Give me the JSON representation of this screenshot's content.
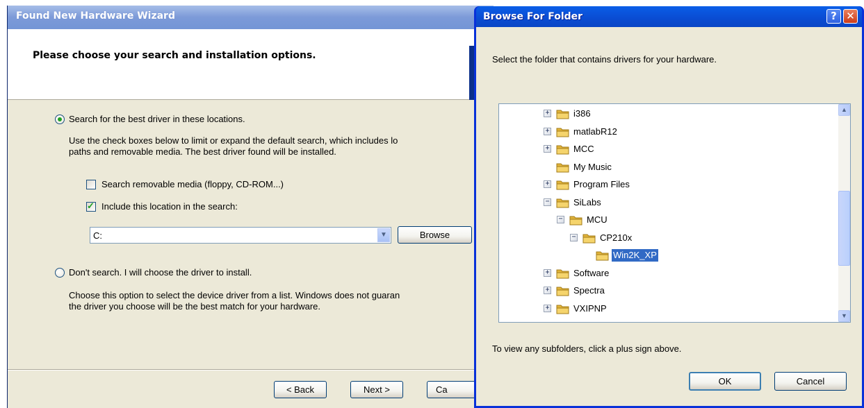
{
  "wizard": {
    "title": "Found New Hardware Wizard",
    "header_title": "Please choose your search and installation options.",
    "option_search": {
      "label": "Search for the best driver in these locations.",
      "selected": true,
      "description_line1": "Use the check boxes below to limit or expand the default search, which includes lo",
      "description_line2": "paths and removable media. The best driver found will be installed."
    },
    "checkbox_removable": {
      "label": "Search removable media (floppy, CD-ROM...)",
      "checked": false
    },
    "checkbox_location": {
      "label": "Include this location in the search:",
      "checked": true
    },
    "location_value": "C:",
    "browse_label": "Browse",
    "option_dont_search": {
      "label": "Don't search. I will choose the driver to install.",
      "selected": false,
      "description_line1": "Choose this option to select the device driver from a list.  Windows does not guaran",
      "description_line2": "the driver you choose will be the best match for your hardware."
    },
    "buttons": {
      "back": "< Back",
      "next": "Next >",
      "cancel": "Ca"
    }
  },
  "browse_dialog": {
    "title": "Browse For Folder",
    "help_button": "?",
    "close_button": "✕",
    "instruction": "Select the folder that contains drivers for your hardware.",
    "tree_items": [
      {
        "label": "i386",
        "expander": "+",
        "level": 0,
        "selected": false
      },
      {
        "label": "matlabR12",
        "expander": "+",
        "level": 0,
        "selected": false
      },
      {
        "label": "MCC",
        "expander": "+",
        "level": 0,
        "selected": false
      },
      {
        "label": "My Music",
        "expander": "",
        "level": 0,
        "selected": false
      },
      {
        "label": "Program Files",
        "expander": "+",
        "level": 0,
        "selected": false
      },
      {
        "label": "SiLabs",
        "expander": "−",
        "level": 0,
        "selected": false
      },
      {
        "label": "MCU",
        "expander": "−",
        "level": 1,
        "selected": false
      },
      {
        "label": "CP210x",
        "expander": "−",
        "level": 2,
        "selected": false
      },
      {
        "label": "Win2K_XP",
        "expander": "",
        "level": 3,
        "selected": true
      },
      {
        "label": "Software",
        "expander": "+",
        "level": 0,
        "selected": false
      },
      {
        "label": "Spectra",
        "expander": "+",
        "level": 0,
        "selected": false
      },
      {
        "label": "VXIPNP",
        "expander": "+",
        "level": 0,
        "selected": false
      }
    ],
    "scroll_up": "▲",
    "scroll_down": "▼",
    "hint": "To view any subfolders, click a plus sign above.",
    "ok_label": "OK",
    "cancel_label": "Cancel"
  },
  "colors": {
    "xp_title_blue": "#0a4cd2",
    "selection_blue": "#316ac5",
    "dialog_face": "#ece9d8",
    "check_green": "#21a121"
  }
}
